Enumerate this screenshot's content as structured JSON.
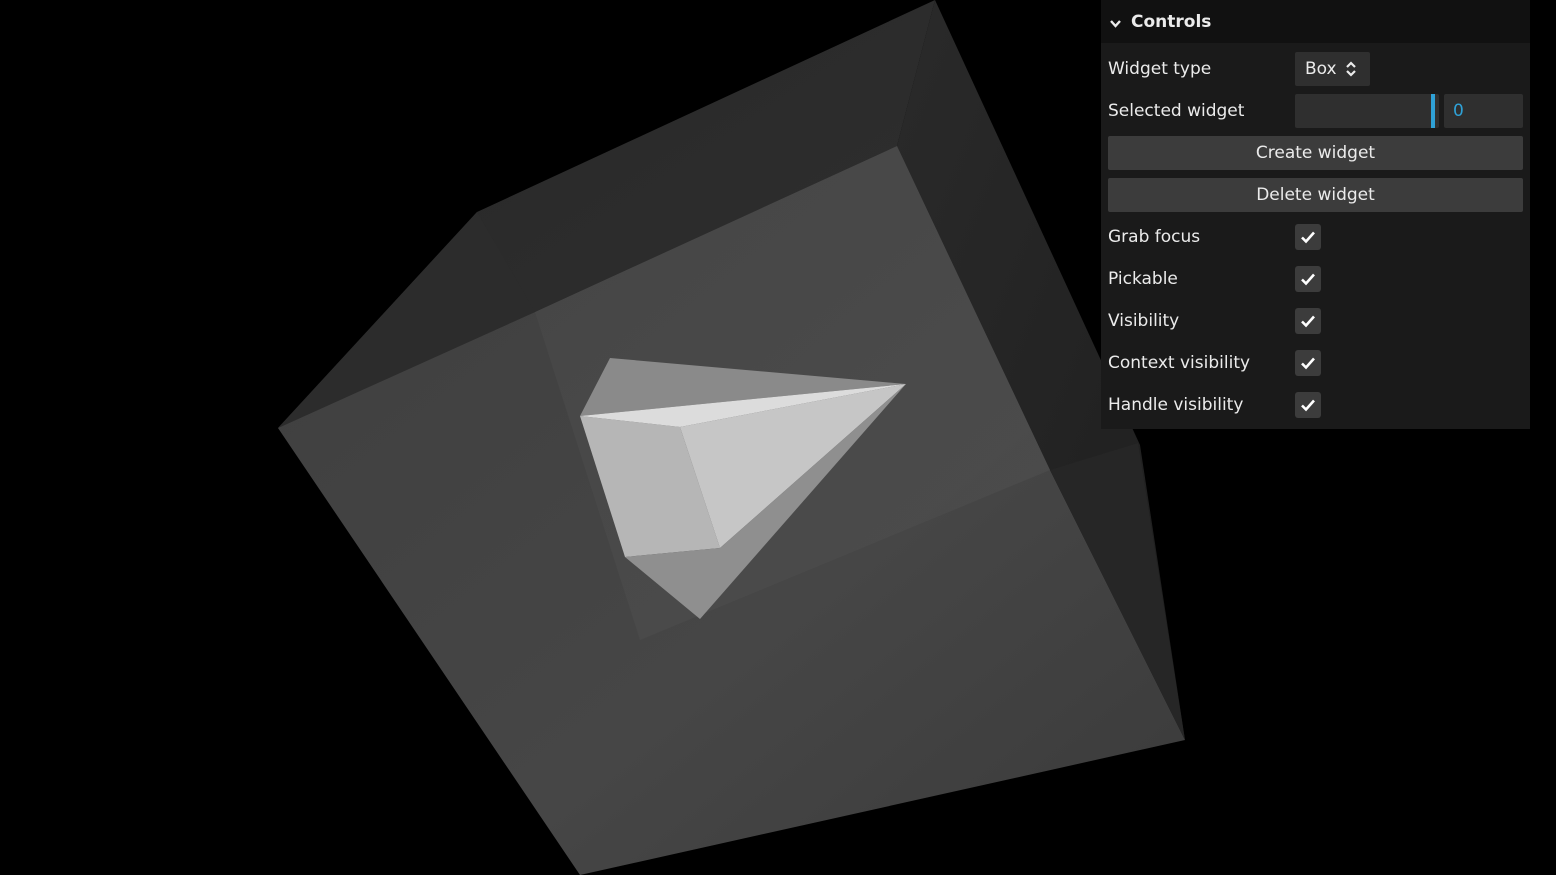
{
  "panel": {
    "title": "Controls",
    "widget_type_label": "Widget type",
    "widget_type_value": "Box",
    "selected_widget_label": "Selected widget",
    "selected_widget_value": "0",
    "create_button": "Create widget",
    "delete_button": "Delete widget",
    "checkboxes": [
      {
        "label": "Grab focus",
        "checked": true
      },
      {
        "label": "Pickable",
        "checked": true
      },
      {
        "label": "Visibility",
        "checked": true
      },
      {
        "label": "Context visibility",
        "checked": true
      },
      {
        "label": "Handle visibility",
        "checked": true
      }
    ]
  },
  "colors": {
    "background": "#000000",
    "panel_bg": "#1a1a1a",
    "panel_header_bg": "#111111",
    "control_bg": "#2f2f2f",
    "button_bg": "#3c3c3c",
    "accent": "#2fa1d6",
    "text": "#ebebeb"
  },
  "icons": {
    "collapse": "chevron-down-icon",
    "select": "up-down-arrows-icon",
    "checkbox": "checkmark-icon"
  }
}
